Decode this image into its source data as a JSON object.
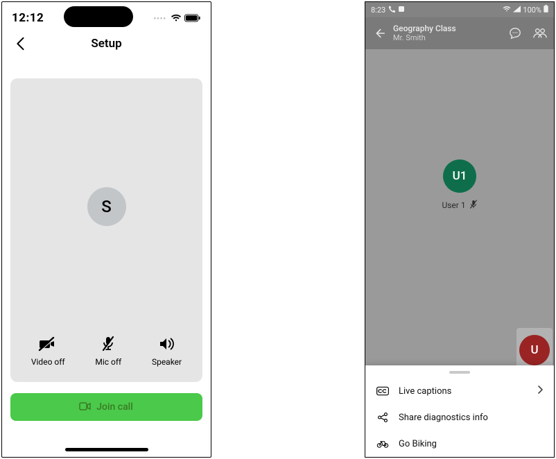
{
  "left": {
    "status": {
      "time": "12:12"
    },
    "header": {
      "title": "Setup"
    },
    "avatar_initial": "S",
    "controls": {
      "video": "Video off",
      "mic": "Mic off",
      "audio": "Speaker"
    },
    "join_button": "Join call"
  },
  "right": {
    "status": {
      "time": "8:23",
      "battery": "100%"
    },
    "header": {
      "title": "Geography Class",
      "subtitle": "Mr. Smith"
    },
    "peer": {
      "initials": "U1",
      "name": "User 1"
    },
    "self": {
      "initial": "U"
    },
    "sheet": {
      "items": [
        {
          "icon": "cc-icon",
          "label": "Live captions",
          "chevron": true
        },
        {
          "icon": "share-icon",
          "label": "Share diagnostics info",
          "chevron": false
        },
        {
          "icon": "bike-icon",
          "label": "Go Biking",
          "chevron": false
        }
      ]
    }
  }
}
